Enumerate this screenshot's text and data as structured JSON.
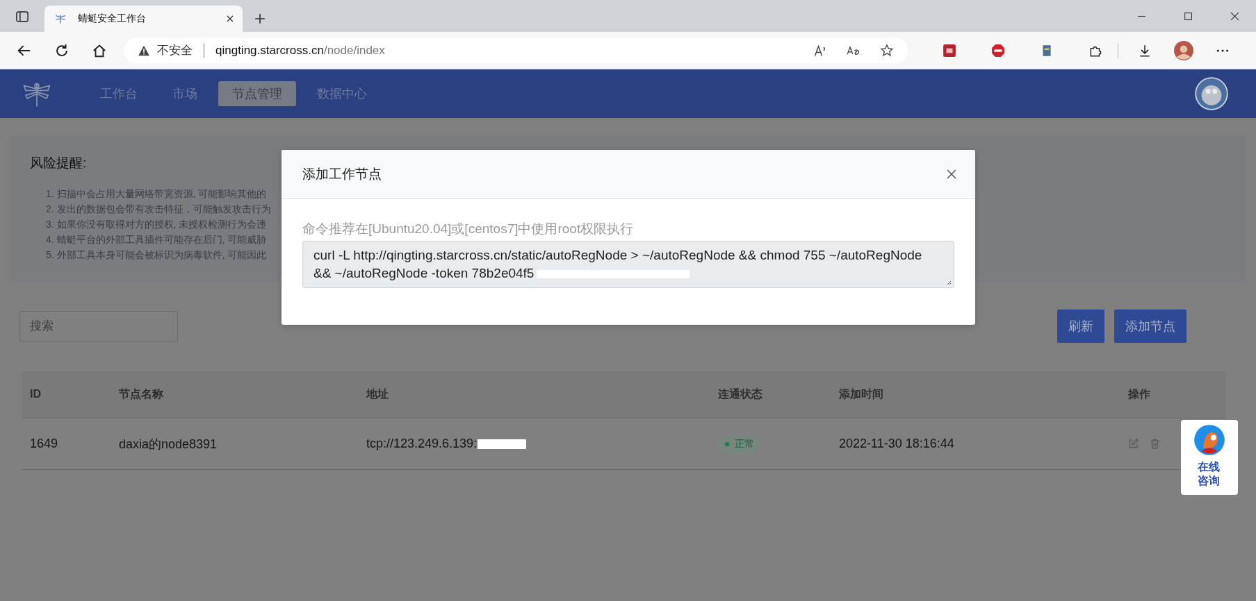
{
  "browser": {
    "tab_title": "蜻蜓安全工作台",
    "security": "不安全",
    "url_host": "qingting.starcross.cn",
    "url_path": "/node/index"
  },
  "nav": {
    "items": [
      {
        "label": "工作台",
        "selected": false
      },
      {
        "label": "市场",
        "selected": false
      },
      {
        "label": "节点管理",
        "selected": true
      },
      {
        "label": "数据中心",
        "selected": false
      }
    ]
  },
  "risk": {
    "title": "风险提醒:",
    "items": [
      "1. 扫描中会占用大量网络带宽资源, 可能影响其他的",
      "2. 发出的数据包会带有攻击特征，可能触发攻击行为",
      "3. 如果你没有取得对方的授权, 未授权检测行为会违",
      "4. 蜻蜓平台的外部工具插件可能存在后门, 可能威胁",
      "5. 外部工具本身可能会被标识为病毒软件, 可能因此"
    ]
  },
  "search": {
    "placeholder": "搜索"
  },
  "buttons": [
    "刷新",
    "添加节点"
  ],
  "table": {
    "columns": [
      "ID",
      "节点名称",
      "地址",
      "连通状态",
      "添加时间",
      "操作"
    ],
    "rows": [
      {
        "id": "1649",
        "name": "daxia的node8391",
        "address": "tcp://123.249.6.139:",
        "status": "正常",
        "time": "2022-11-30 18:16:44"
      }
    ]
  },
  "modal": {
    "title": "添加工作节点",
    "hint": "命令推荐在[Ubuntu20.04]或[centos7]中使用root权限执行",
    "command": "curl -L http://qingting.starcross.cn/static/autoRegNode > ~/autoRegNode && chmod 755 ~/autoRegNode && ~/autoRegNode -token 78b2e04f5"
  },
  "chat": {
    "label": "在线咨询"
  }
}
